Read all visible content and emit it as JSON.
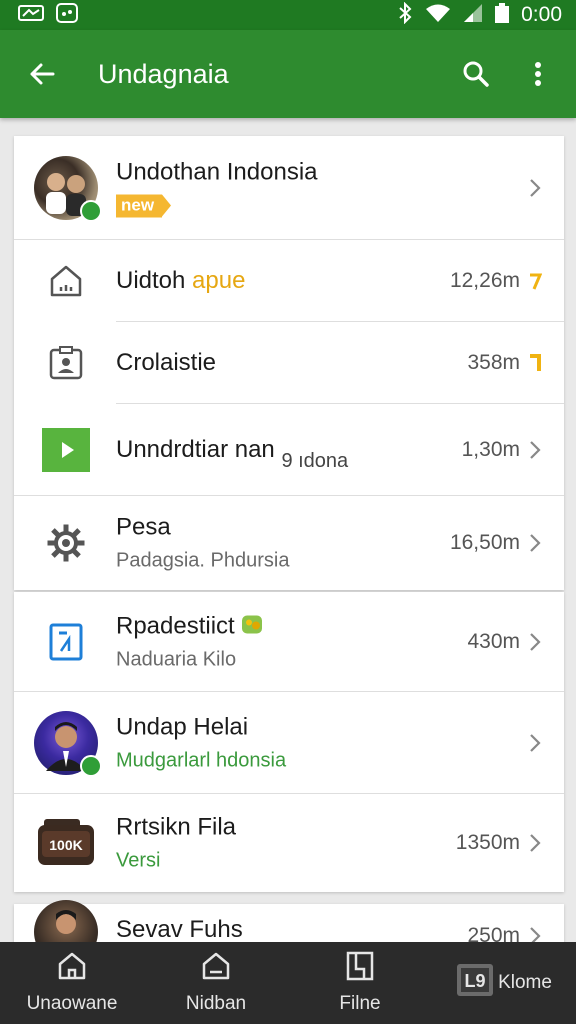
{
  "status_bar": {
    "time": "0:00",
    "icons": [
      "notification-icon",
      "app-icon",
      "bluetooth-icon",
      "wifi-icon",
      "signal-icon",
      "battery-icon"
    ]
  },
  "app_bar": {
    "title": "Undagnaia",
    "icons": [
      "back-arrow-icon",
      "search-icon",
      "more-vert-icon"
    ]
  },
  "list": {
    "header": {
      "title": "Undothan Indonsia",
      "badge": "new"
    },
    "items": [
      {
        "title_main": "Uidtoh",
        "title_accent": "apue",
        "meta": "12,26m",
        "meta_icon": "yellow-mark-icon",
        "icon": "home-icon"
      },
      {
        "title": "Crolaistie",
        "meta": "358m",
        "meta_icon": "yellow-bracket-icon",
        "icon": "contact-card-icon"
      },
      {
        "title": "Unndrdtiar nan",
        "title_small": "9 ıdona",
        "meta": "1,30m",
        "icon": "play-icon"
      },
      {
        "title": "Pesa",
        "subtitle": "Padagsia. Phdursia",
        "meta": "16,50m",
        "icon": "gear-icon"
      }
    ],
    "items2": [
      {
        "title": "Rpadestiict",
        "subtitle": "Naduaria Kilo",
        "meta": "430m",
        "icon": "document-icon"
      },
      {
        "title": "Undap Helai",
        "subtitle": "Mudgarlarl hdonsia",
        "icon": "avatar-man"
      },
      {
        "title": "Rrtsikn Fila",
        "subtitle": "Versi",
        "meta": "1350m",
        "icon": "box-100k-icon",
        "icon_text": "100K"
      },
      {
        "title": "Sevav Fuhs",
        "meta": "250m",
        "icon": "avatar-partial"
      }
    ]
  },
  "nav": {
    "items": [
      {
        "label": "Unaowane",
        "icon": "home-icon"
      },
      {
        "label": "Nidban",
        "icon": "home-icon"
      },
      {
        "label": "Filne",
        "icon": "file-icon"
      },
      {
        "label": "Klome",
        "icon": "gallery-icon"
      }
    ]
  },
  "colors": {
    "status_bar": "#1f7a22",
    "app_bar": "#2e8b2f",
    "accent_green": "#4caf50",
    "badge": "#f5b731",
    "navbar": "#2b2b2b"
  }
}
